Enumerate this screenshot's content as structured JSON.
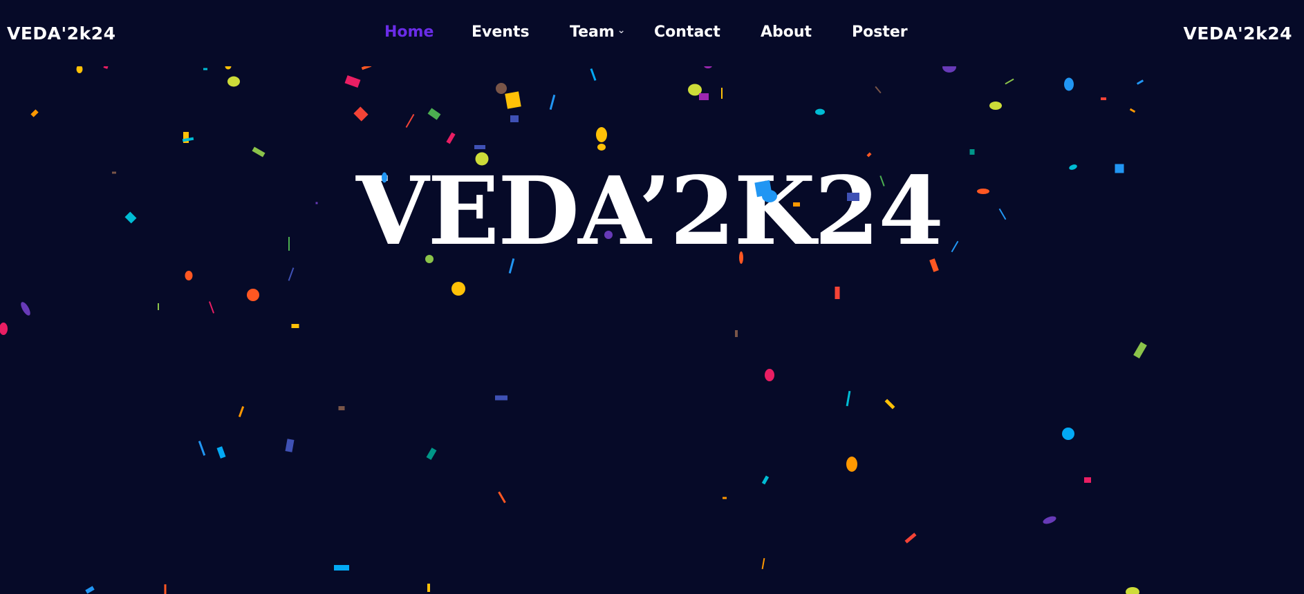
{
  "header": {
    "brand_left": "VEDA'2k24",
    "brand_right": "VEDA'2k24",
    "nav": [
      {
        "label": "Home",
        "active": true
      },
      {
        "label": "Events",
        "active": false
      },
      {
        "label": "Team",
        "active": false,
        "has_dropdown": true
      },
      {
        "label": "Contact",
        "active": false
      },
      {
        "label": "About",
        "active": false
      },
      {
        "label": "Poster",
        "active": false
      }
    ],
    "dropdown_icon": "chevron-down-icon"
  },
  "hero": {
    "title": "VEDA’2K24"
  },
  "colors": {
    "background": "#060a28",
    "active_nav": "#6a2ce8",
    "text": "#ffffff",
    "confetti_palette": [
      "#e91e63",
      "#ffc107",
      "#cddc39",
      "#2196f3",
      "#00bcd4",
      "#4caf50",
      "#ff5722",
      "#673ab7",
      "#3f51b5",
      "#8bc34a",
      "#9c27b0",
      "#f44336",
      "#009688",
      "#03a9f4",
      "#ff9800",
      "#795548",
      "#ffeb3b"
    ]
  }
}
